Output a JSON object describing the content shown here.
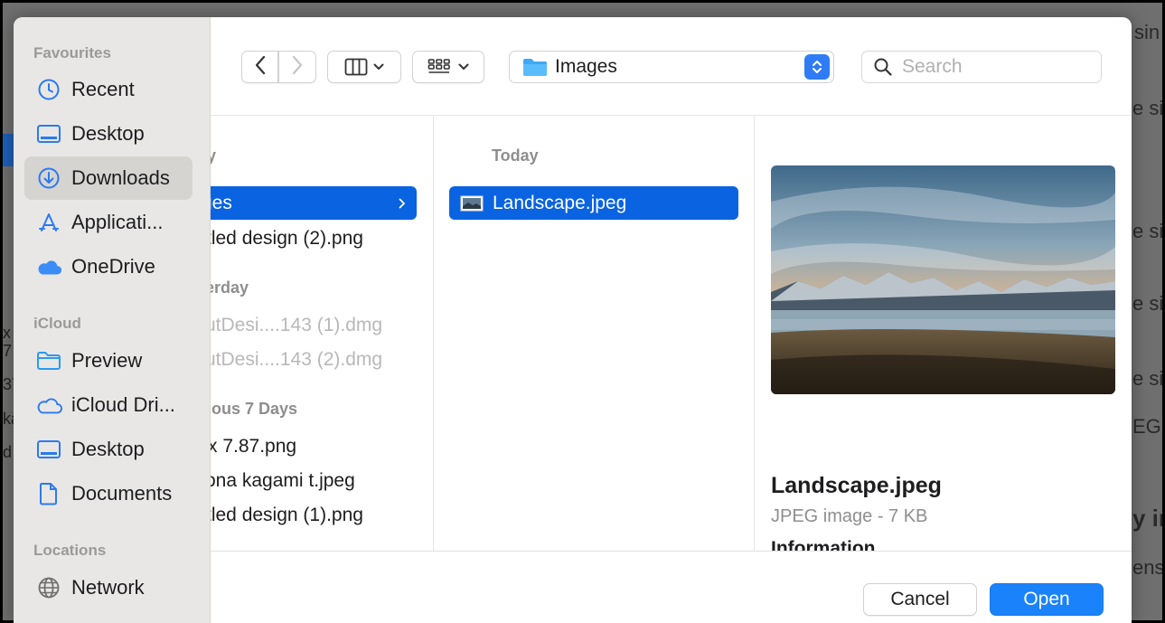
{
  "background_app": {
    "right_fragments": [
      "sin",
      "e si",
      "e si",
      "e si",
      "e si",
      "EG",
      "y in",
      "ens"
    ],
    "left_fragments": [
      "x",
      "7",
      "37",
      "ka",
      "d"
    ]
  },
  "sidebar": {
    "sections": [
      {
        "title": "Favourites",
        "items": [
          {
            "label": "Recent",
            "icon": "clock-icon"
          },
          {
            "label": "Desktop",
            "icon": "desktop-icon"
          },
          {
            "label": "Downloads",
            "icon": "download-icon",
            "active": true
          },
          {
            "label": "Applicati...",
            "icon": "applications-icon"
          },
          {
            "label": "OneDrive",
            "icon": "cloud-filled-icon"
          }
        ]
      },
      {
        "title": "iCloud",
        "items": [
          {
            "label": "Preview",
            "icon": "folder-icon"
          },
          {
            "label": "iCloud Dri...",
            "icon": "cloud-icon"
          },
          {
            "label": "Desktop",
            "icon": "desktop-icon"
          },
          {
            "label": "Documents",
            "icon": "document-icon"
          }
        ]
      },
      {
        "title": "Locations",
        "items": [
          {
            "label": "Network",
            "icon": "globe-icon"
          }
        ]
      }
    ]
  },
  "toolbar": {
    "back": "‹",
    "forward": "›",
    "view_mode": "columns",
    "group_mode": "grid",
    "path": "Images",
    "search_placeholder": "Search"
  },
  "column1": {
    "groups": [
      {
        "title": "y",
        "items": [
          {
            "label": "ges",
            "selected": true
          },
          {
            "label": "tled design (2).png"
          }
        ]
      },
      {
        "title": "erday",
        "items": [
          {
            "label": "utDesi....143 (1).dmg",
            "dimmed": true
          },
          {
            "label": "utDesi....143 (2).dmg",
            "dimmed": true
          }
        ]
      },
      {
        "title": "ious 7 Days",
        "items": [
          {
            "label": "x 7.87.png"
          },
          {
            "label": "ona kagami t.jpeg"
          },
          {
            "label": "tled design (1).png"
          }
        ]
      }
    ]
  },
  "column2": {
    "group_title": "Today",
    "items": [
      {
        "label": "Landscape.jpeg",
        "selected": true
      }
    ]
  },
  "preview": {
    "file_name": "Landscape.jpeg",
    "meta": "JPEG image - 7 KB",
    "info_heading": "Information"
  },
  "buttons": {
    "cancel": "Cancel",
    "open": "Open"
  },
  "colors": {
    "accent": "#0a63e0",
    "primary_button": "#1a82fb",
    "sidebar_bg": "#e9e7e5"
  }
}
